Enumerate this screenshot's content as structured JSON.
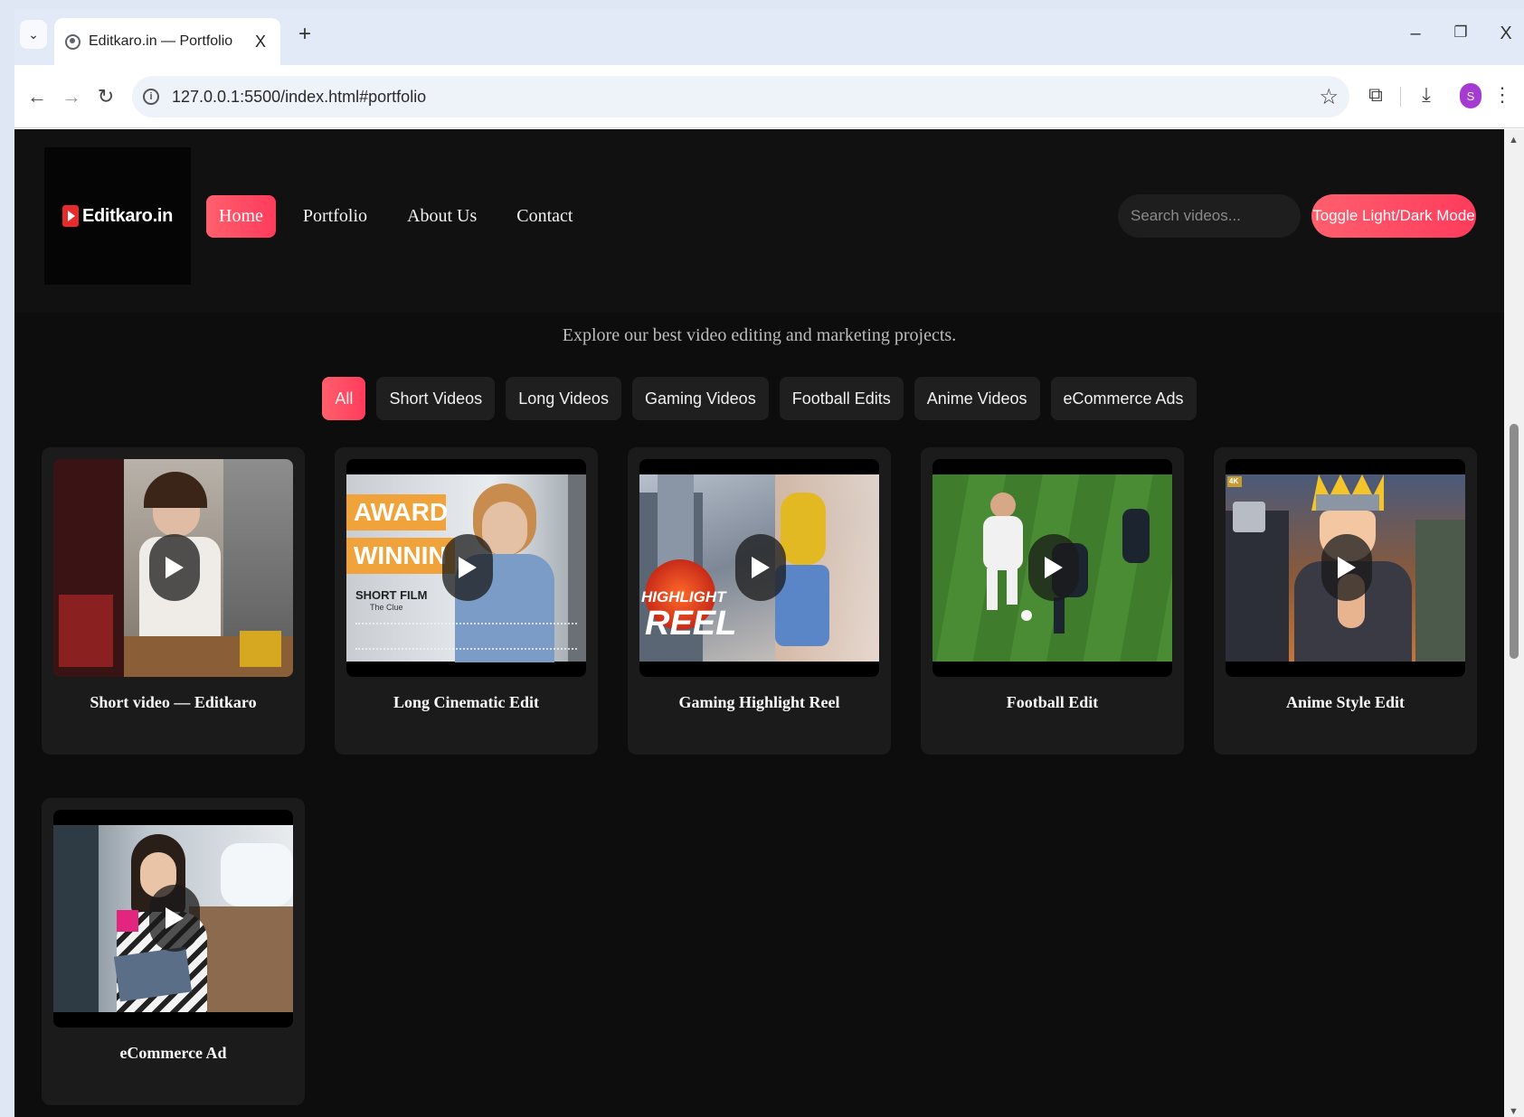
{
  "browser": {
    "tab_title": "Editkaro.in — Portfolio",
    "tab_close": "X",
    "new_tab": "+",
    "url": "127.0.0.1:5500/index.html#portfolio",
    "profile_initial": "S",
    "window": {
      "minimize": "–",
      "restore": "❐",
      "close": "X"
    }
  },
  "header": {
    "logo_text": "Editkaro.in",
    "nav": [
      {
        "label": "Home",
        "active": true
      },
      {
        "label": "Portfolio",
        "active": false
      },
      {
        "label": "About Us",
        "active": false
      },
      {
        "label": "Contact",
        "active": false
      }
    ],
    "search_placeholder": "Search videos...",
    "toggle_label": "Toggle Light/Dark Mode"
  },
  "portfolio": {
    "tagline": "Explore our best video editing and marketing projects.",
    "filters": [
      {
        "label": "All",
        "active": true
      },
      {
        "label": "Short Videos",
        "active": false
      },
      {
        "label": "Long Videos",
        "active": false
      },
      {
        "label": "Gaming Videos",
        "active": false
      },
      {
        "label": "Football Edits",
        "active": false
      },
      {
        "label": "Anime Videos",
        "active": false
      },
      {
        "label": "eCommerce Ads",
        "active": false
      }
    ],
    "cards": [
      {
        "title": "Short video — Editkaro"
      },
      {
        "title": "Long Cinematic Edit",
        "thumb_text": [
          "AWARD",
          "WINNIN",
          "SHORT FILM",
          "The Clue"
        ]
      },
      {
        "title": "Gaming Highlight Reel",
        "thumb_text": [
          "HIGHLIGHT",
          "REEL"
        ]
      },
      {
        "title": "Football Edit"
      },
      {
        "title": "Anime Style Edit",
        "thumb_text": [
          "4K"
        ]
      },
      {
        "title": "eCommerce Ad"
      }
    ]
  },
  "colors": {
    "accent": "#ff4d63",
    "page_bg": "#0d0d0d",
    "card_bg": "#1b1b1b"
  }
}
